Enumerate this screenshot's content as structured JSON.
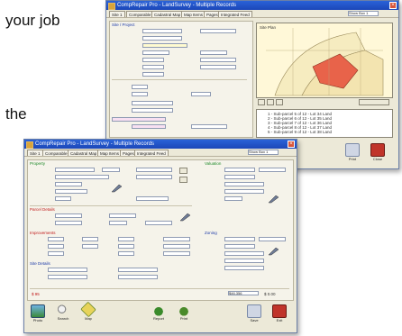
{
  "background": {
    "line1": "your job",
    "line2": "the"
  },
  "back_window": {
    "title": "CompRepair Pro - LandSurvey - Multiple Records",
    "active_entry": "Show Box 1",
    "tabs": [
      "Site 1",
      "Comparable",
      "Cadastral Map",
      "Map Items",
      "Pages",
      "Integrated Feed"
    ],
    "panel_heading": "Site / Project",
    "list_lines": [
      "1 - Sub-parcel 5 of 12 - Lot 34 Land",
      "2 - Sub-parcel 6 of 12 - Lot 35 Land",
      "3 - Sub-parcel 7 of 12 - Lot 36 Land",
      "4 - Sub-parcel 8 of 12 - Lot 37 Land",
      "5 - Sub-parcel 9 of 12 - Lot 38 Land"
    ],
    "map_label": "Site Plan",
    "buttons": {
      "print": "Print",
      "close": "Close"
    }
  },
  "front_window": {
    "title": "CompRepair Pro - LandSurvey - Multiple Records",
    "active_entry": "Show Box 1",
    "tabs": [
      "Site 1",
      "Comparable",
      "Cadastral Map",
      "Map Items",
      "Pages",
      "Integrated Feed"
    ],
    "sections": {
      "property": "Property",
      "parcel_details": "Parcel Details",
      "improvements": "Improvements",
      "valuation": "Valuation",
      "site_details": "Site Details",
      "zoning": "Zoning"
    },
    "totals": {
      "left": "$ 95",
      "right": "$46,356",
      "right_extra": "$ 0.00"
    },
    "toolbar": [
      {
        "label": "Photo"
      },
      {
        "label": "Search"
      },
      {
        "label": "Map"
      },
      {
        "label": "Report"
      },
      {
        "label": "Print"
      },
      {
        "label": "Save"
      },
      {
        "label": "Exit"
      }
    ]
  },
  "colors": {
    "title_bar": "#1c47b8",
    "window_bg": "#ece9d8",
    "map_shape": "#e8634a",
    "map_bg": "#fff8d8"
  }
}
